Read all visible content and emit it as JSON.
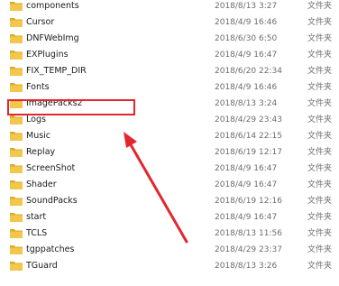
{
  "files": [
    {
      "name": "components",
      "date": "2018/8/13 3:27",
      "type": "文件夹"
    },
    {
      "name": "Cursor",
      "date": "2018/4/9 16:46",
      "type": "文件夹"
    },
    {
      "name": "DNFWebImg",
      "date": "2018/6/30 6:50",
      "type": "文件夹"
    },
    {
      "name": "EXPlugins",
      "date": "2018/4/9 16:47",
      "type": "文件夹"
    },
    {
      "name": "FIX_TEMP_DIR",
      "date": "2018/6/20 22:34",
      "type": "文件夹"
    },
    {
      "name": "Fonts",
      "date": "2018/4/9 16:46",
      "type": "文件夹"
    },
    {
      "name": "ImagePacks2",
      "date": "2018/8/13 3:24",
      "type": "文件夹"
    },
    {
      "name": "Logs",
      "date": "2018/4/29 23:43",
      "type": "文件夹"
    },
    {
      "name": "Music",
      "date": "2018/6/14 22:15",
      "type": "文件夹"
    },
    {
      "name": "Replay",
      "date": "2018/6/19 12:17",
      "type": "文件夹"
    },
    {
      "name": "ScreenShot",
      "date": "2018/4/9 16:47",
      "type": "文件夹"
    },
    {
      "name": "Shader",
      "date": "2018/4/9 16:47",
      "type": "文件夹"
    },
    {
      "name": "SoundPacks",
      "date": "2018/6/19 12:16",
      "type": "文件夹"
    },
    {
      "name": "start",
      "date": "2018/4/9 16:47",
      "type": "文件夹"
    },
    {
      "name": "TCLS",
      "date": "2018/8/13 11:56",
      "type": "文件夹"
    },
    {
      "name": "tgppatches",
      "date": "2018/4/29 23:37",
      "type": "文件夹"
    },
    {
      "name": "TGuard",
      "date": "2018/8/13 3:26",
      "type": "文件夹"
    }
  ],
  "highlighted_item": "ImagePacks2",
  "colors": {
    "annotation_red": "#e2262e",
    "folder_yellow": "#f3c74c",
    "folder_dark": "#dcaa2a"
  },
  "icons": {
    "folder": "folder-icon"
  }
}
